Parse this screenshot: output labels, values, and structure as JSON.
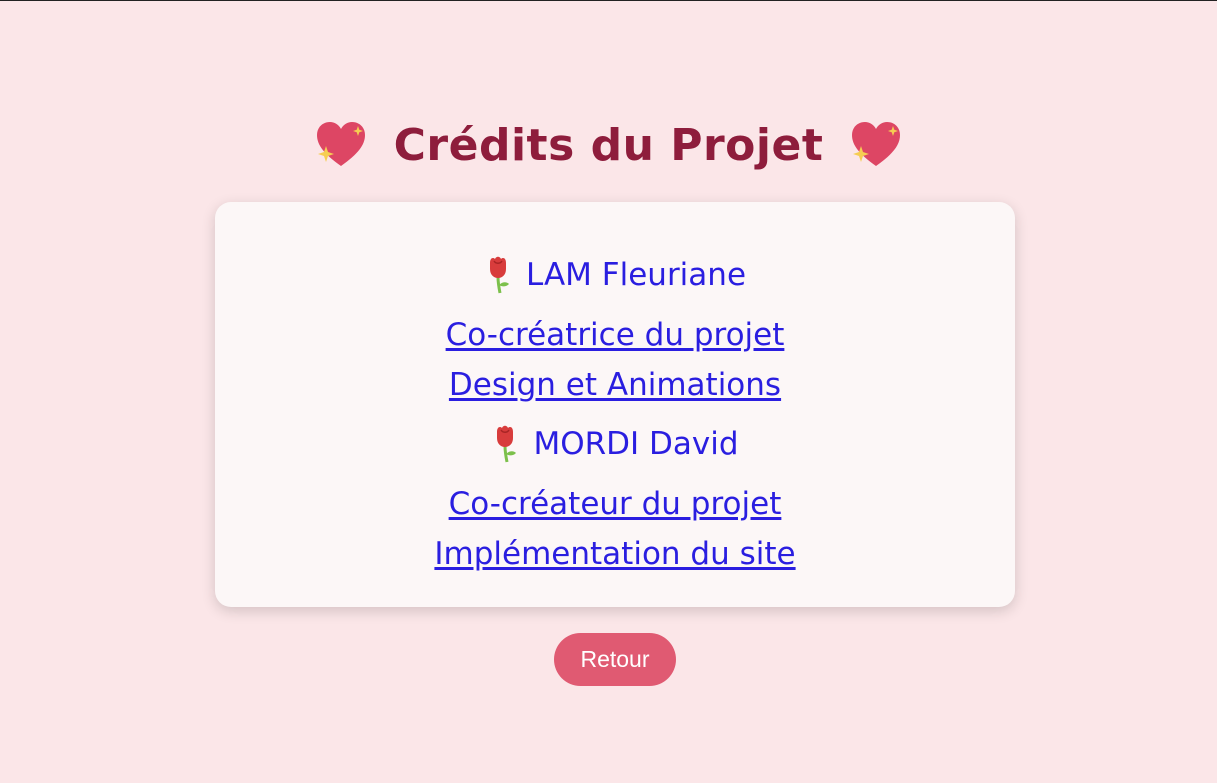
{
  "header": {
    "title": "Crédits du Projet",
    "left_icon": "sparkling-heart-icon",
    "right_icon": "sparkling-heart-icon"
  },
  "credits": [
    {
      "icon": "rose-icon",
      "name": "LAM Fleuriane",
      "role": "Co-créatrice du projet",
      "task": "Design et Animations"
    },
    {
      "icon": "rose-icon",
      "name": "MORDI David",
      "role": "Co-créateur du projet",
      "task": "Implémentation du site"
    }
  ],
  "back_button": {
    "label": "Retour"
  },
  "colors": {
    "background": "#fbe6e8",
    "title": "#8e1d3c",
    "link": "#2a1ee0",
    "button": "#e05a72",
    "card": "#fcf7f7"
  }
}
